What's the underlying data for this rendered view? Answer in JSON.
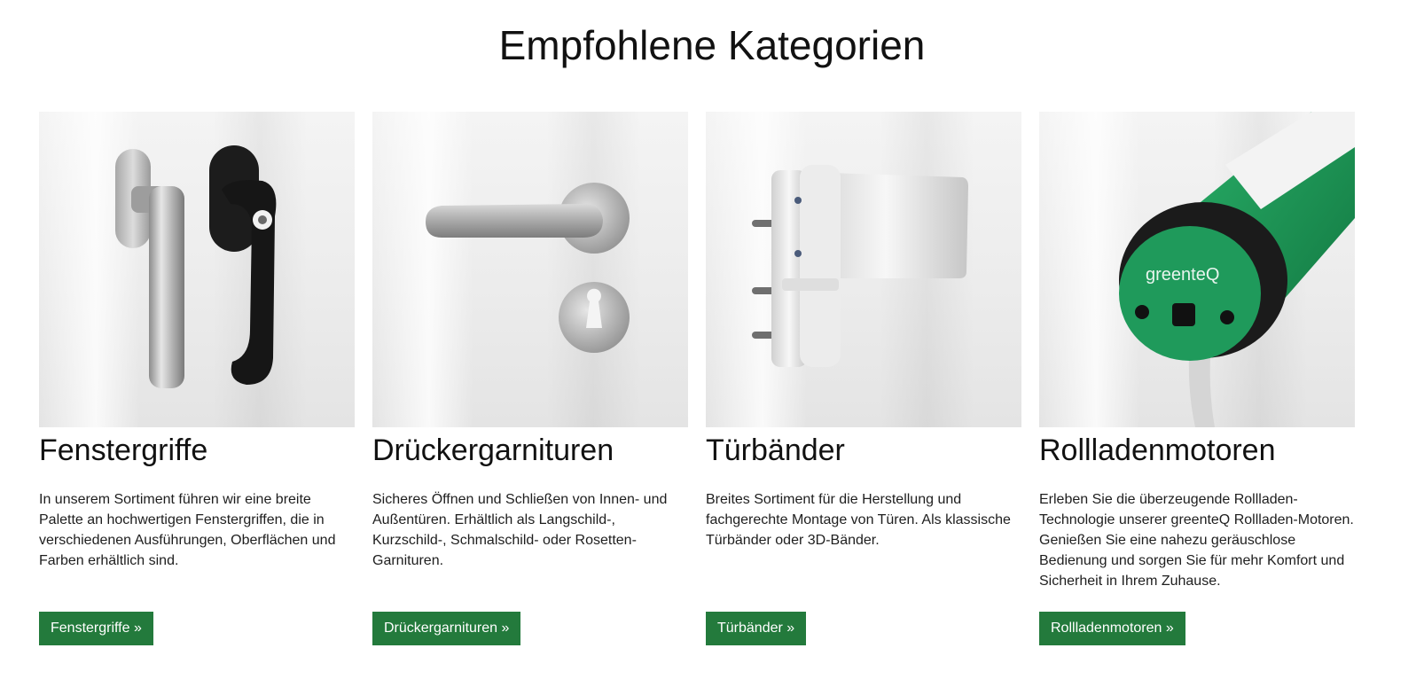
{
  "section": {
    "title": "Empfohlene Kategorien"
  },
  "categories": [
    {
      "title": "Fenstergriffe",
      "text": "In unserem Sortiment führen wir eine breite Palette an hochwertigen Fenstergriffen, die in verschiedenen Ausführungen, Oberflächen und Farben erhältlich sind.",
      "button": "Fenstergriffe »",
      "image_icon": "window-handles-image"
    },
    {
      "title": "Drückergarnituren",
      "text": "Sicheres Öffnen und Schließen von Innen- und Außentüren. Erhältlich als Langschild-, Kurzschild-, Schmalschild- oder Rosetten-Garnituren.",
      "button": "Drückergarnituren »",
      "image_icon": "door-handle-set-image"
    },
    {
      "title": "Türbänder",
      "text": "Breites Sortiment für die Herstellung und fachgerechte Montage von Türen. Als klassische Türbänder oder 3D-Bänder.",
      "button": "Türbänder »",
      "image_icon": "door-hinge-image"
    },
    {
      "title": "Rollladenmotoren",
      "text": "Erleben Sie die überzeugende Rollladen-Technologie unserer greenteQ Rollladen-Motoren. Genießen Sie eine nahezu geräuschlose Bedienung und sorgen Sie für mehr Komfort und Sicherheit in Ihrem Zuhause.",
      "button": "Rollladenmotoren »",
      "image_icon": "roller-shutter-motor-image",
      "image_label": "greenteQ"
    }
  ],
  "colors": {
    "button_bg": "#237a3c",
    "button_text": "#ffffff",
    "motor_green": "#1f9a5b"
  }
}
